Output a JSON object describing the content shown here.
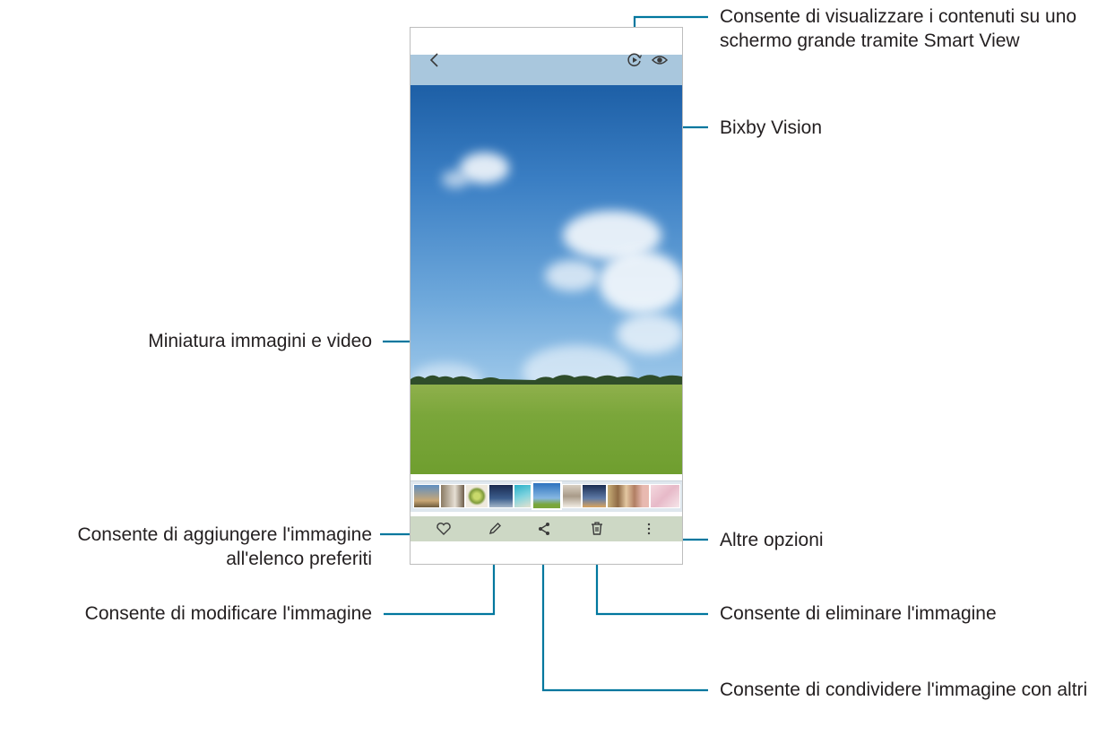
{
  "callouts": {
    "smart_view": "Consente di visualizzare i contenuti su uno schermo grande tramite Smart View",
    "bixby_vision": "Bixby Vision",
    "thumbnails": "Miniatura immagini e video",
    "favorites": "Consente di aggiungere l'immagine all'elenco preferiti",
    "edit": "Consente di modificare l'immagine",
    "share": "Consente di condividere l'immagine con altri",
    "delete": "Consente di eliminare l'immagine",
    "more": "Altre opzioni"
  },
  "phone": {
    "top_icons": [
      "back-icon",
      "smart-view-icon",
      "bixby-vision-icon"
    ],
    "toolbar_icons": [
      "heart-icon",
      "pencil-icon",
      "share-icon",
      "trash-icon",
      "more-options-icon"
    ],
    "thumbnail_count": 10
  },
  "colors": {
    "line": "#00779e",
    "text": "#231f20"
  }
}
